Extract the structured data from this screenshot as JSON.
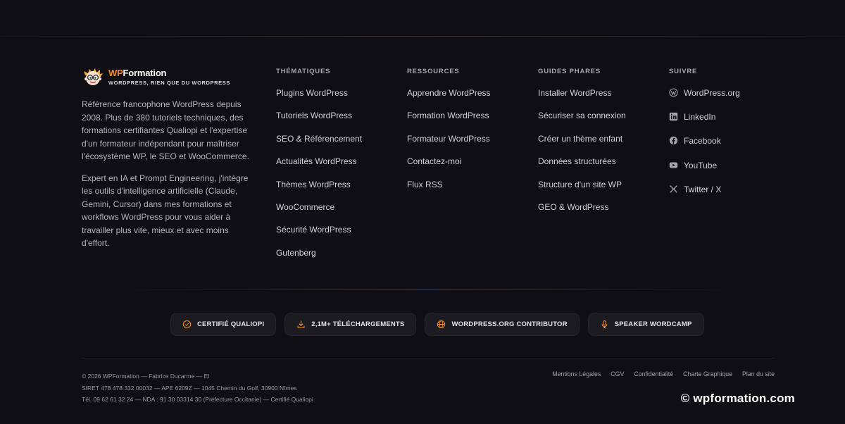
{
  "brand": {
    "logo_wp": "WP",
    "logo_rest": "Formation",
    "tagline": "WORDPRESS, RIEN QUE DU WORDPRESS",
    "paragraph1": "Référence francophone WordPress depuis 2008. Plus de 380 tutoriels techniques, des formations certifiantes Qualiopi et l'expertise d'un formateur indépendant pour maîtriser l'écosystème WP, le SEO et WooCommerce.",
    "paragraph2": "Expert en IA et Prompt Engineering, j'intègre les outils d'intelligence artificielle (Claude, Gemini, Cursor) dans mes formations et workflows WordPress pour vous aider à travailler plus vite, mieux et avec moins d'effort."
  },
  "columns": {
    "thematiques": {
      "title": "THÉMATIQUES",
      "items": [
        "Plugins WordPress",
        "Tutoriels WordPress",
        "SEO & Référencement",
        "Actualités WordPress",
        "Thèmes WordPress",
        "WooCommerce",
        "Sécurité WordPress",
        "Gutenberg"
      ]
    },
    "ressources": {
      "title": "RESSOURCES",
      "items": [
        "Apprendre WordPress",
        "Formation WordPress",
        "Formateur WordPress",
        "Contactez-moi",
        "Flux RSS"
      ]
    },
    "guides": {
      "title": "GUIDES PHARES",
      "items": [
        "Installer WordPress",
        "Sécuriser sa connexion",
        "Créer un thème enfant",
        "Données structurées",
        "Structure d'un site WP",
        "GEO & WordPress"
      ]
    },
    "suivre": {
      "title": "SUIVRE",
      "items": [
        {
          "label": "WordPress.org",
          "icon": "wordpress-icon"
        },
        {
          "label": "LinkedIn",
          "icon": "linkedin-icon"
        },
        {
          "label": "Facebook",
          "icon": "facebook-icon"
        },
        {
          "label": "YouTube",
          "icon": "youtube-icon"
        },
        {
          "label": "Twitter / X",
          "icon": "x-icon"
        }
      ]
    }
  },
  "badges": [
    {
      "label": "CERTIFIÉ QUALIOPI",
      "icon": "check-circle-icon"
    },
    {
      "label": "2,1M+ TÉLÉCHARGEMENTS",
      "icon": "download-icon"
    },
    {
      "label": "WORDPRESS.ORG CONTRIBUTOR",
      "icon": "globe-icon"
    },
    {
      "label": "SPEAKER WORDCAMP",
      "icon": "microphone-icon"
    }
  ],
  "legal": {
    "line1": "© 2026 WPFormation — Fabrice Ducarme — EI",
    "line2": "SIRET 478 478 332 00032 — APE 6209Z — 1045 Chemin du Golf, 30900 Nîmes",
    "line3": "Tél. 09 62 61 32 24 — NDA : 91 30 03314 30 (Préfecture Occitanie) — Certifié Qualiopi"
  },
  "legal_links": [
    "Mentions Légales",
    "CGV",
    "Confidentialité",
    "Charte Graphique",
    "Plan du site"
  ],
  "watermark": "© wpformation.com",
  "colors": {
    "accent": "#f28c1e",
    "background": "#0f0e14",
    "badge_bg": "#1c1b22"
  }
}
